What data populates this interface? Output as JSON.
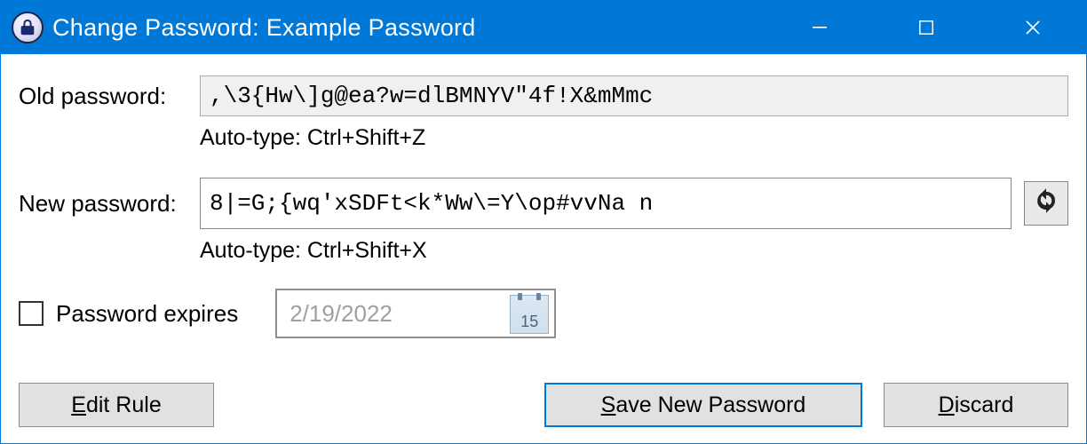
{
  "window": {
    "title": "Change Password: Example Password"
  },
  "old": {
    "label": "Old password:",
    "value": ",\\3{Hw\\]g@ea?w=dlBMNYV\"4f!X&mMmc",
    "autotype": "Auto-type: Ctrl+Shift+Z"
  },
  "new": {
    "label": "New password:",
    "value": "8|=G;{wq'xSDFt<k*Ww\\=Y\\op#vvNa n",
    "autotype": "Auto-type: Ctrl+Shift+X"
  },
  "expires": {
    "label": "Password expires",
    "date": "2/19/2022",
    "calendar_day": "15"
  },
  "buttons": {
    "edit_rule_pre": "E",
    "edit_rule_rest": "dit Rule",
    "save_pre": "S",
    "save_rest": "ave New Password",
    "discard_pre": "D",
    "discard_rest": "iscard"
  }
}
